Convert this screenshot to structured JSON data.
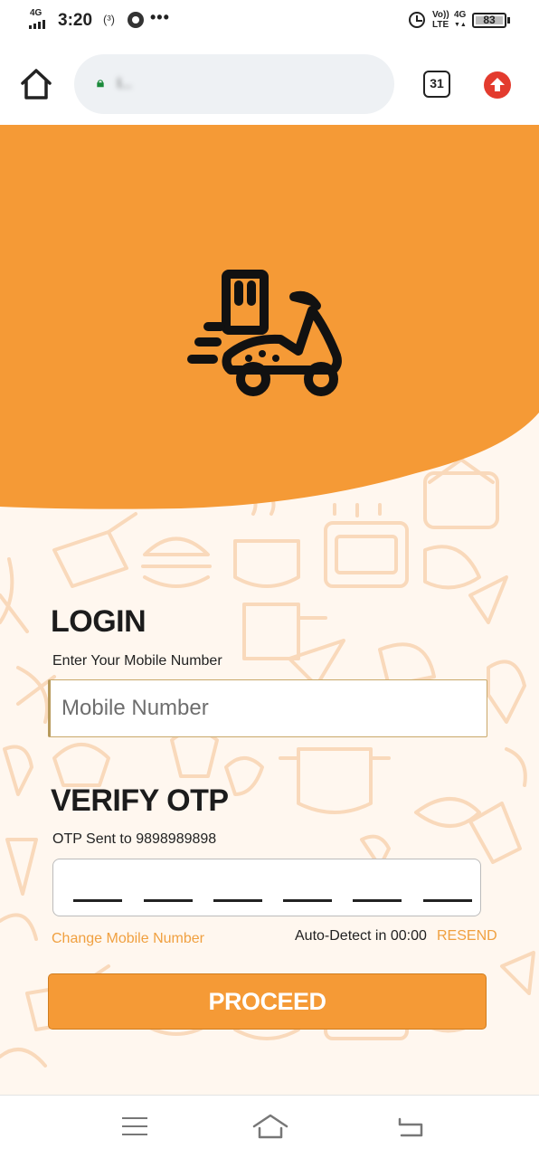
{
  "status_bar": {
    "network": "4G",
    "time": "3:20",
    "hotspot": "(³)",
    "more": "•••",
    "volte_top": "Vo))",
    "volte_bottom": "LTE",
    "network2_top": "4G",
    "network2_bottom": "▼▲",
    "battery": "83"
  },
  "browser": {
    "url": "l...",
    "tab_count": "31",
    "icons": [
      "home-icon",
      "lock-icon",
      "tabs-icon",
      "update-arrow-icon"
    ]
  },
  "login": {
    "title": "LOGIN",
    "subtitle": "Enter Your Mobile Number",
    "mobile_placeholder": "Mobile Number"
  },
  "verify": {
    "title": "VERIFY OTP",
    "sent_to": "OTP Sent to 9898989898",
    "otp_slots": 6,
    "change_link": "Change Mobile Number",
    "autodetect": "Auto-Detect in 00:00",
    "resend": "RESEND"
  },
  "proceed_label": "PROCEED",
  "colors": {
    "accent": "#f59a36",
    "link": "#f0a040",
    "background_pattern": "#fff7ef",
    "update_red": "#e33b2e"
  }
}
